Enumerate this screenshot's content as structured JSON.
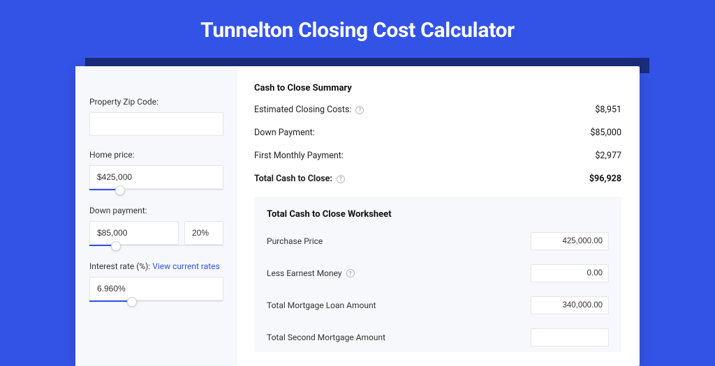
{
  "header": {
    "title": "Tunnelton Closing Cost Calculator"
  },
  "left": {
    "zip_label": "Property Zip Code:",
    "zip_value": "",
    "home_price_label": "Home price:",
    "home_price_value": "$425,000",
    "home_price_slider_pct": 23,
    "down_payment_label": "Down payment:",
    "down_payment_value": "$85,000",
    "down_payment_pct_value": "20%",
    "down_payment_slider_pct": 20,
    "interest_label": "Interest rate (%): ",
    "interest_link": "View current rates",
    "interest_value": "6.960%",
    "interest_slider_pct": 32
  },
  "summary": {
    "title": "Cash to Close Summary",
    "rows": [
      {
        "label": "Estimated Closing Costs:",
        "help": true,
        "value": "$8,951",
        "bold": false
      },
      {
        "label": "Down Payment:",
        "help": false,
        "value": "$85,000",
        "bold": false
      },
      {
        "label": "First Monthly Payment:",
        "help": false,
        "value": "$2,977",
        "bold": false
      },
      {
        "label": "Total Cash to Close:",
        "help": true,
        "value": "$96,928",
        "bold": true
      }
    ]
  },
  "worksheet": {
    "title": "Total Cash to Close Worksheet",
    "rows": [
      {
        "label": "Purchase Price",
        "help": false,
        "value": "425,000.00"
      },
      {
        "label": "Less Earnest Money",
        "help": true,
        "value": "0.00"
      },
      {
        "label": "Total Mortgage Loan Amount",
        "help": false,
        "value": "340,000.00"
      },
      {
        "label": "Total Second Mortgage Amount",
        "help": false,
        "value": ""
      }
    ]
  }
}
